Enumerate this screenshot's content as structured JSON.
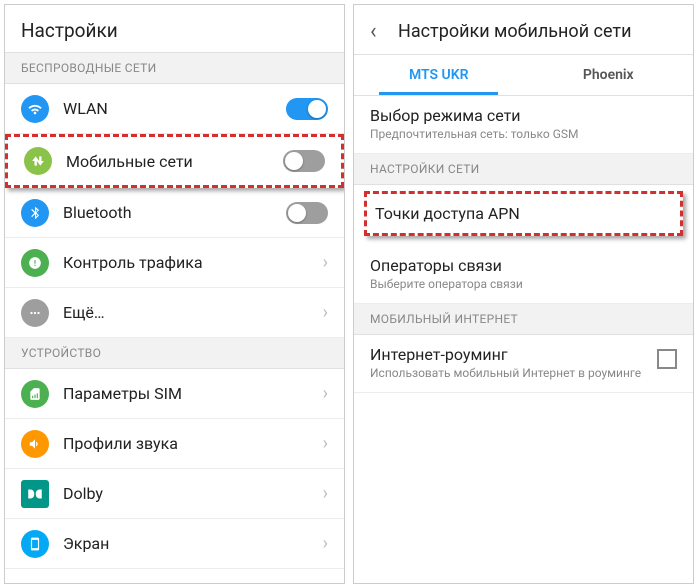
{
  "left": {
    "title": "Настройки",
    "sections": {
      "wireless_header": "БЕСПРОВОДНЫЕ СЕТИ",
      "device_header": "УСТРОЙСТВО"
    },
    "items": {
      "wlan": "WLAN",
      "mobile": "Мобильные сети",
      "bluetooth": "Bluetooth",
      "traffic": "Контроль трафика",
      "more": "Ещё…",
      "sim": "Параметры SIM",
      "sound": "Профили звука",
      "dolby": "Dolby",
      "screen": "Экран"
    }
  },
  "right": {
    "title": "Настройки мобильной сети",
    "tabs": {
      "t1": "MTS UKR",
      "t2": "Phoenix"
    },
    "mode_title": "Выбор режима сети",
    "mode_sub": "Предпочтительная сеть: только GSM",
    "net_section": "НАСТРОЙКИ СЕТИ",
    "apn": "Точки доступа APN",
    "operators_title": "Операторы связи",
    "operators_sub": "Выберите оператора связи",
    "mobile_internet_section": "МОБИЛЬНЫЙ ИНТЕРНЕТ",
    "roaming_title": "Интернет-роуминг",
    "roaming_sub": "Использовать мобильный Интернет в роуминге"
  }
}
